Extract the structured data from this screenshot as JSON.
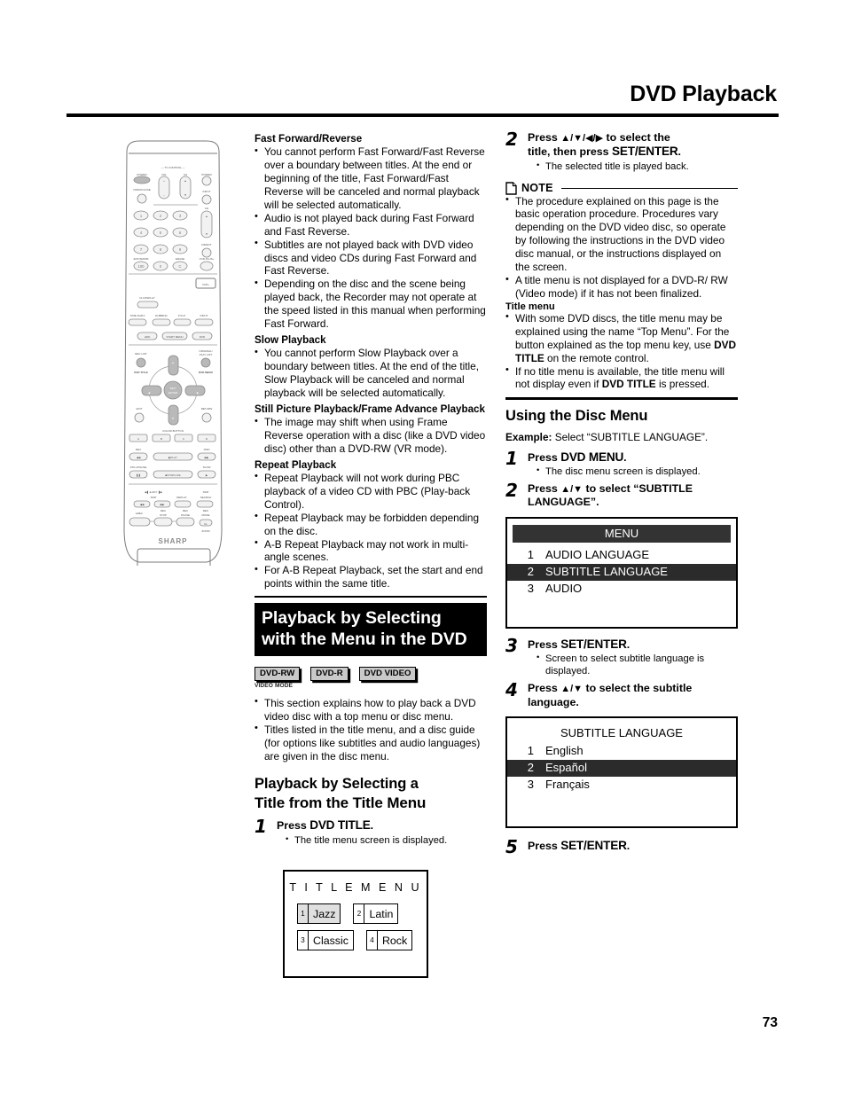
{
  "header": {
    "title": "DVD Playback"
  },
  "page_number": "73",
  "left_column": {
    "sections": [
      {
        "heading": "Fast Forward/Reverse",
        "bullets": [
          "You cannot perform Fast Forward/Fast Reverse over a boundary between titles. At the end or beginning of the title, Fast Forward/Fast Reverse will be canceled and normal playback will be selected automatically.",
          "Audio is not played back during Fast Forward and Fast Reverse.",
          "Subtitles are not played back with DVD video discs and video CDs during Fast Forward and Fast Reverse.",
          "Depending on the disc and the scene being played back, the Recorder may not operate at the speed listed in this manual when performing Fast Forward."
        ]
      },
      {
        "heading": "Slow Playback",
        "bullets": [
          "You cannot perform Slow Playback over a boundary between titles. At the end of the title, Slow Playback will be canceled and normal playback will be selected automatically."
        ]
      },
      {
        "heading": "Still Picture Playback/Frame Advance Playback",
        "bullets": [
          "The image may shift when using Frame Reverse operation with a disc (like a DVD video disc) other than a DVD-RW (VR mode)."
        ]
      },
      {
        "heading": "Repeat Playback",
        "bullets": [
          "Repeat Playback will not work during PBC playback of a video CD with PBC (Play-back Control).",
          "Repeat Playback may be forbidden depending on the disc.",
          "A-B Repeat Playback may not work in multi-angle scenes.",
          "For A-B Repeat Playback, set the start and end points within the same title."
        ]
      }
    ],
    "banner": "Playback by Selecting with the Menu in the DVD",
    "badges": [
      {
        "label": "DVD-RW",
        "sub": "VIDEO MODE"
      },
      {
        "label": "DVD-R",
        "sub": ""
      },
      {
        "label": "DVD VIDEO",
        "sub": ""
      }
    ],
    "intro_bullets": [
      "This section explains how to play back a DVD video disc with a top menu or disc menu.",
      "Titles listed in the title menu, and a disc guide (for options like subtitles and audio languages) are given in the disc menu."
    ],
    "section_title_line1": "Playback by Selecting a",
    "section_title_line2": "Title from the Title Menu",
    "step1": {
      "num": "1",
      "press": "Press ",
      "key": "DVD TITLE",
      "period": ".",
      "bullets": [
        "The title menu screen is displayed."
      ]
    },
    "title_menu_screen": {
      "title": "T I T L E   M E N U",
      "items": [
        {
          "n": "1",
          "label": "Jazz",
          "selected": true
        },
        {
          "n": "2",
          "label": "Latin",
          "selected": false
        },
        {
          "n": "3",
          "label": "Classic",
          "selected": false
        },
        {
          "n": "4",
          "label": "Rock",
          "selected": false
        }
      ]
    }
  },
  "right_column": {
    "step2": {
      "num": "2",
      "line1_a": "Press ",
      "arrows": "▲/▼/◀/▶",
      "line1_b": " to select the",
      "line2_a": "title, then press ",
      "line2_key": "SET/ENTER",
      "line2_b": ".",
      "bullets": [
        "The selected title is played back."
      ]
    },
    "note": {
      "label": "NOTE",
      "bullets": [
        "The procedure explained on this page is the basic operation procedure. Procedures vary depending on the DVD video disc, so operate by following the instructions in the DVD video disc manual, or the instructions displayed on the screen.",
        "A title menu is not displayed for a DVD-R/ RW (Video mode) if it has not been finalized."
      ],
      "subheading": "Title menu",
      "sub_bullets_html": [
        "With some DVD discs, the title menu may be explained using the name “Top Menu”. For the button explained as the top menu key, use <b>DVD TITLE</b> on the remote control.",
        "If no title menu is available, the title menu will not display even if <b>DVD TITLE</b> is pressed."
      ]
    },
    "disc_menu_heading": "Using the Disc Menu",
    "example_label": "Example:",
    "example_text": " Select “SUBTITLE LANGUAGE”.",
    "step_dm1": {
      "num": "1",
      "press": "Press ",
      "key": "DVD MENU",
      "period": ".",
      "bullets": [
        "The disc menu screen is displayed."
      ]
    },
    "step_dm2": {
      "num": "2",
      "line1_a": "Press ",
      "arrows": "▲/▼",
      "line1_b": " to select “SUBTITLE",
      "line2": "LANGUAGE”."
    },
    "menu_screen": {
      "header": "MENU",
      "items": [
        {
          "n": "1",
          "label": "AUDIO LANGUAGE",
          "selected": false
        },
        {
          "n": "2",
          "label": "SUBTITLE LANGUAGE",
          "selected": true
        },
        {
          "n": "3",
          "label": "AUDIO",
          "selected": false
        }
      ]
    },
    "step_dm3": {
      "num": "3",
      "press": "Press ",
      "key": "SET/ENTER",
      "period": ".",
      "bullets": [
        "Screen to select subtitle language is displayed."
      ]
    },
    "step_dm4": {
      "num": "4",
      "line1_a": "Press ",
      "arrows": "▲/▼",
      "line1_b": " to select the subtitle",
      "line2": "language."
    },
    "subtitle_screen": {
      "title": "SUBTITLE LANGUAGE",
      "items": [
        {
          "n": "1",
          "label": "English",
          "selected": false
        },
        {
          "n": "2",
          "label": "Español",
          "selected": true
        },
        {
          "n": "3",
          "label": "Français",
          "selected": false
        }
      ]
    },
    "step_dm5": {
      "num": "5",
      "press": "Press ",
      "key": "SET/ENTER",
      "period": "."
    }
  },
  "remote": {
    "brand": "SHARP",
    "labels": {
      "tv_control": "— TV CONTROL —",
      "power": "POWER",
      "vol": "VOL",
      "ch": "CH",
      "power2": "POWER",
      "open_close": "OPEN/CLOSE",
      "input": "INPUT",
      "ch2": "CH",
      "direct": "DIRECT",
      "ent_am_pm": "ENT/AM/PM",
      "erase": "ERASE",
      "vcrplus": "VCR PLUS+",
      "ch_display": "CH DISPLAY",
      "time_shift": "TIME SHIFT",
      "dubbing": "DUBBING",
      "p_in_p": "P IN P",
      "input2": "INPUT",
      "hdd": "HDD",
      "start_menu": "START MENU",
      "dvd": "DVD",
      "rec_list": "REC LIST",
      "original_play_list": "ORIGINAL/ PLAY LIST",
      "dvd_title": "DVD TITLE",
      "dvd_menu": "DVD MENU",
      "set_enter": "SET/ ENTER",
      "exit": "EXIT",
      "return": "RETURN",
      "color_button": "COLOR BUTTON",
      "a": "A",
      "b": "B",
      "c": "C",
      "d": "D",
      "rev": "REV",
      "fwd": "FWD",
      "play": "PLAY",
      "still_pause": "STILL/PAUSE",
      "slow": "SLOW",
      "stop_live": "STOP/LIVE",
      "eady": "E ADY",
      "skip": "SKIP",
      "replay": "REPLAY",
      "skip_search": "SKIP SEARCH",
      "rec": "REC",
      "rec_stop": "REC STOP",
      "rec_pause": "REC PAUSE",
      "rec_mode": "REC MODE",
      "zoom": "ZOOM",
      "cl": "CL",
      "keys": [
        "1",
        "2",
        "3",
        "4",
        "5",
        "6",
        "7",
        "8",
        "9",
        "100",
        "0",
        "C"
      ]
    }
  }
}
